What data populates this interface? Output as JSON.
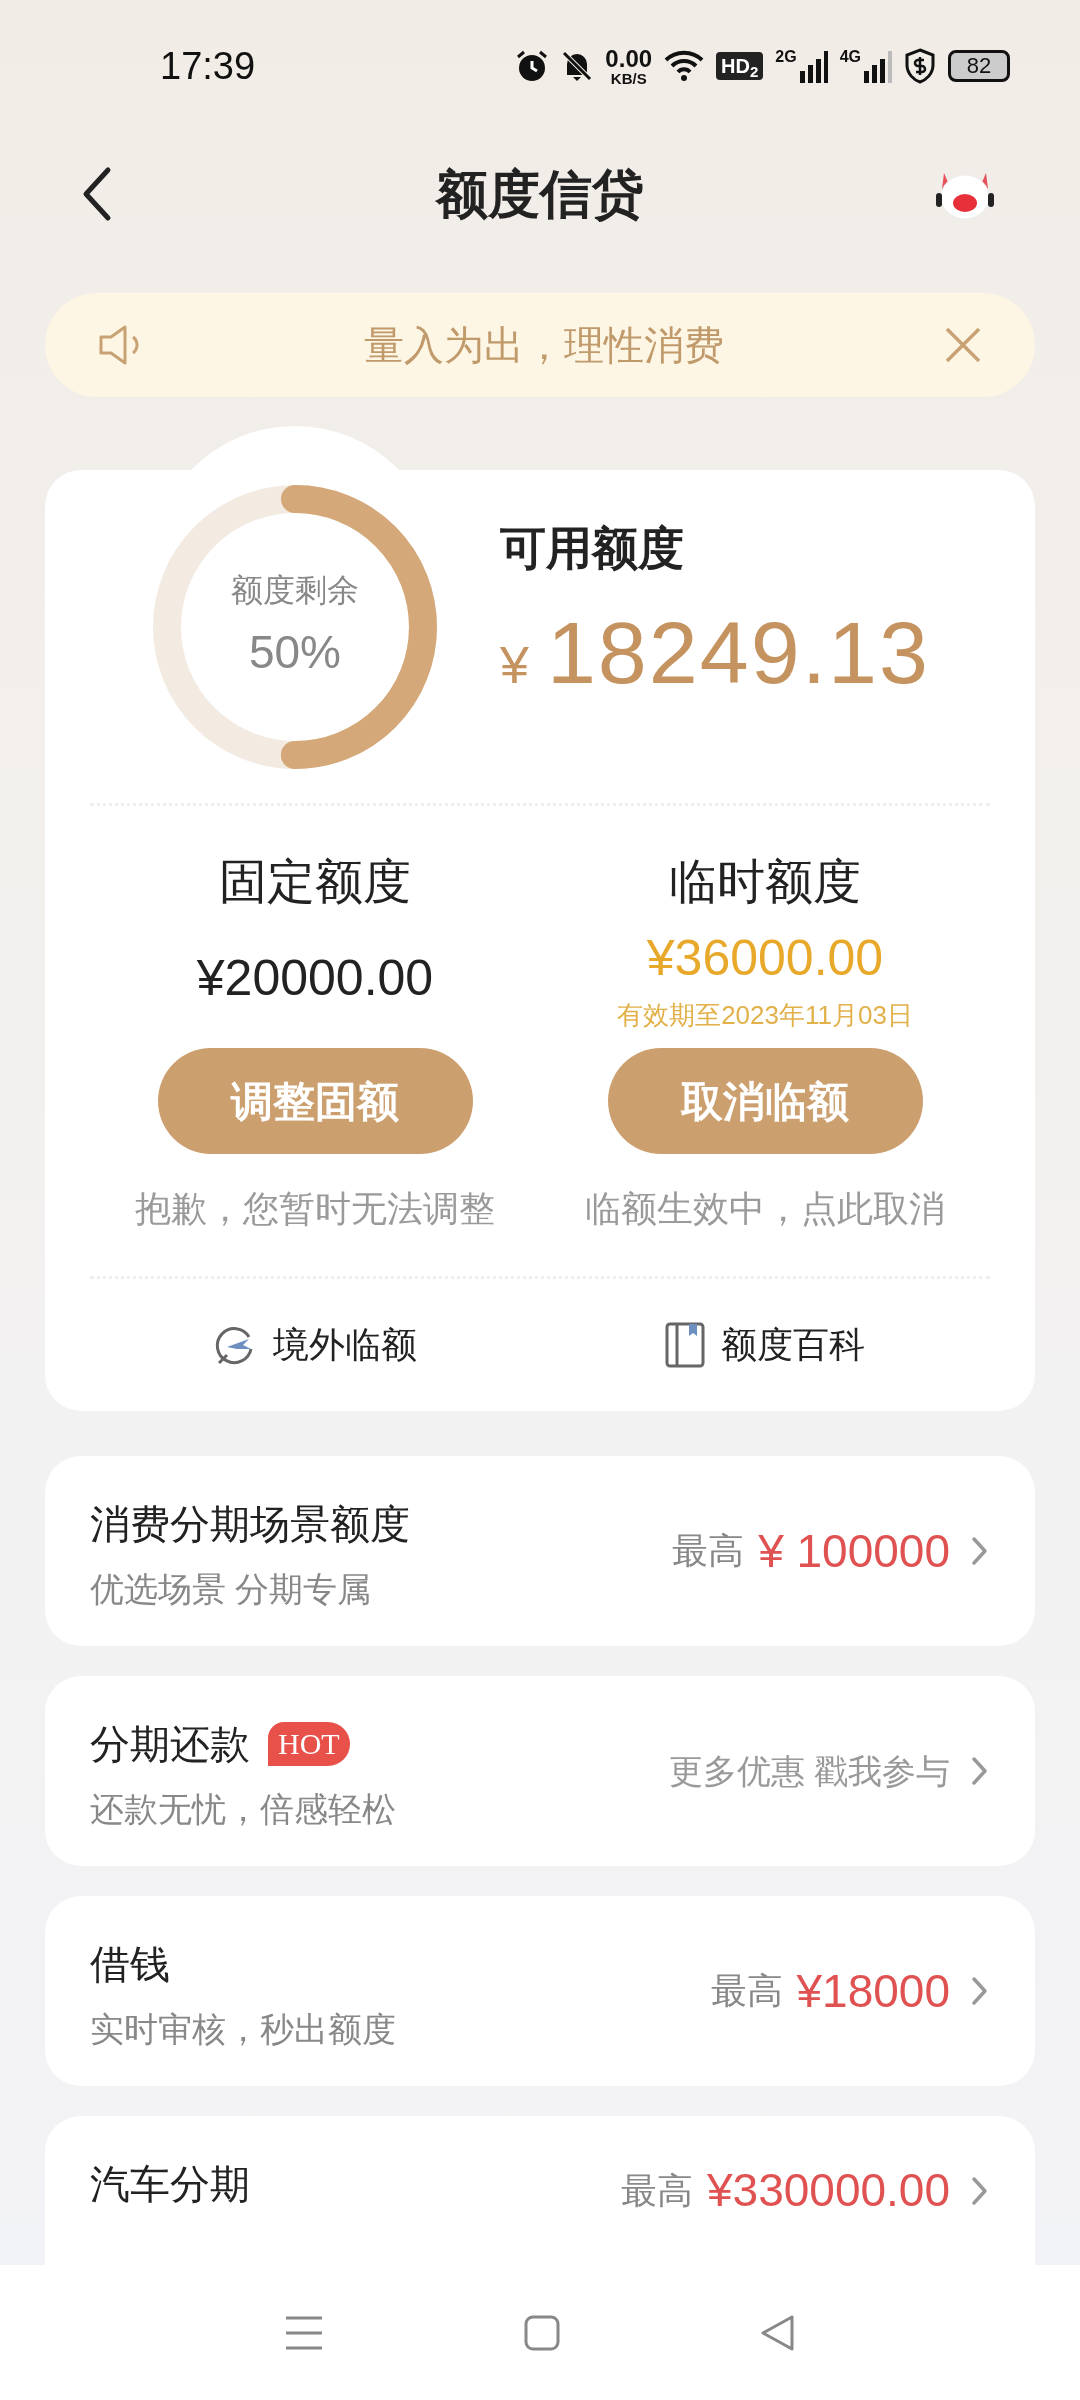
{
  "status_bar": {
    "time": "17:39",
    "net_speed": "0.00",
    "net_unit": "KB/S",
    "hd": "HD$_{2}$",
    "sim1": "2G",
    "sim2": "4G",
    "battery": "82"
  },
  "header": {
    "title": "额度信贷"
  },
  "notice": {
    "text": "量入为出，理性消费"
  },
  "summary": {
    "gauge": {
      "label": "额度剩余",
      "percent": "50%",
      "level": 0.5
    },
    "available_label": "可用额度",
    "currency": "¥",
    "available_amount": "18249.13"
  },
  "quotas": [
    {
      "kind": "fixed",
      "title": "固定额度",
      "amount": "¥20000.00",
      "button": "调整固额",
      "hint": "抱歉，您暂时无法调整"
    },
    {
      "kind": "temporary",
      "title": "临时额度",
      "amount": "¥36000.00",
      "validity": "有效期至2023年11月03日",
      "button": "取消临额",
      "hint": "临额生效中，点此取消"
    }
  ],
  "links": [
    {
      "kind": "plane",
      "label": "境外临额"
    },
    {
      "kind": "book",
      "label": "额度百科"
    }
  ],
  "products": [
    {
      "title": "消费分期场景额度",
      "subtitle": "优选场景 分期专属",
      "prefix": "最高",
      "amount": "¥ 100000"
    },
    {
      "title": "分期还款",
      "badge": "HOT",
      "subtitle": "还款无忧，倍感轻松",
      "promo": "更多优惠 戳我参与"
    },
    {
      "title": "借钱",
      "subtitle": "实时审核，秒出额度",
      "prefix": "最高",
      "amount": "¥18000"
    },
    {
      "title": "汽车分期",
      "prefix": "最高",
      "amount": "¥330000.00"
    }
  ]
}
